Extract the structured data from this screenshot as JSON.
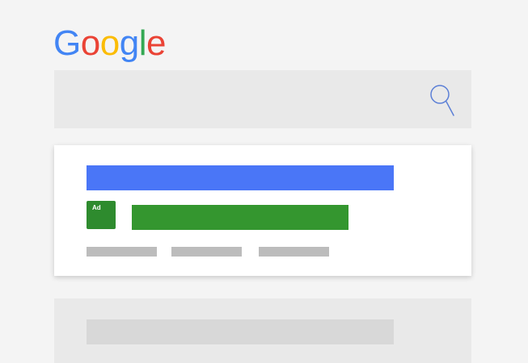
{
  "logo": {
    "letters": [
      "G",
      "o",
      "o",
      "g",
      "l",
      "e"
    ]
  },
  "search": {
    "icon": "search-icon"
  },
  "ad_result": {
    "badge_label": "Ad"
  },
  "colors": {
    "logo_blue": "#4285f4",
    "logo_red": "#ea4335",
    "logo_yellow": "#fbbc05",
    "logo_green": "#34a853",
    "title_bar": "#4a76f7",
    "ad_badge": "#2e8b2e",
    "url_bar": "#34962f",
    "snippet_bar": "#bcbcbc",
    "search_box": "#e9e9e9",
    "search_icon_stroke": "#5b7fd6"
  }
}
